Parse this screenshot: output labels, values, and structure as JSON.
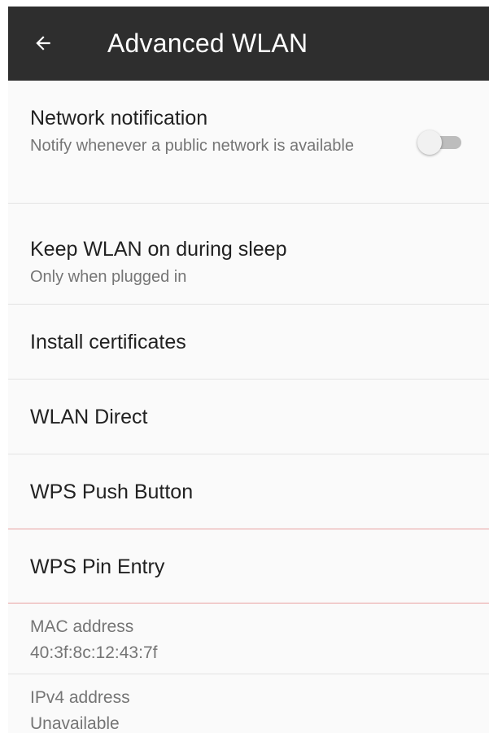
{
  "appbar": {
    "back_icon": "arrow-left-icon",
    "title": "Advanced WLAN",
    "background": "#2e2e2e"
  },
  "settings": {
    "network_notification": {
      "title": "Network notification",
      "summary": "Notify whenever a public network is available",
      "toggle_on": false
    },
    "keep_wlan_on": {
      "title": "Keep WLAN on during sleep",
      "summary": "Only when plugged in"
    },
    "install_certificates": {
      "title": "Install certificates"
    },
    "wlan_direct": {
      "title": "WLAN Direct"
    },
    "wps_push_button": {
      "title": "WPS Push Button"
    },
    "wps_pin_entry": {
      "title": "WPS Pin Entry"
    }
  },
  "info": {
    "mac": {
      "label": "MAC address",
      "value": "40:3f:8c:12:43:7f"
    },
    "ipv4": {
      "label": "IPv4 address",
      "value": "Unavailable"
    }
  }
}
